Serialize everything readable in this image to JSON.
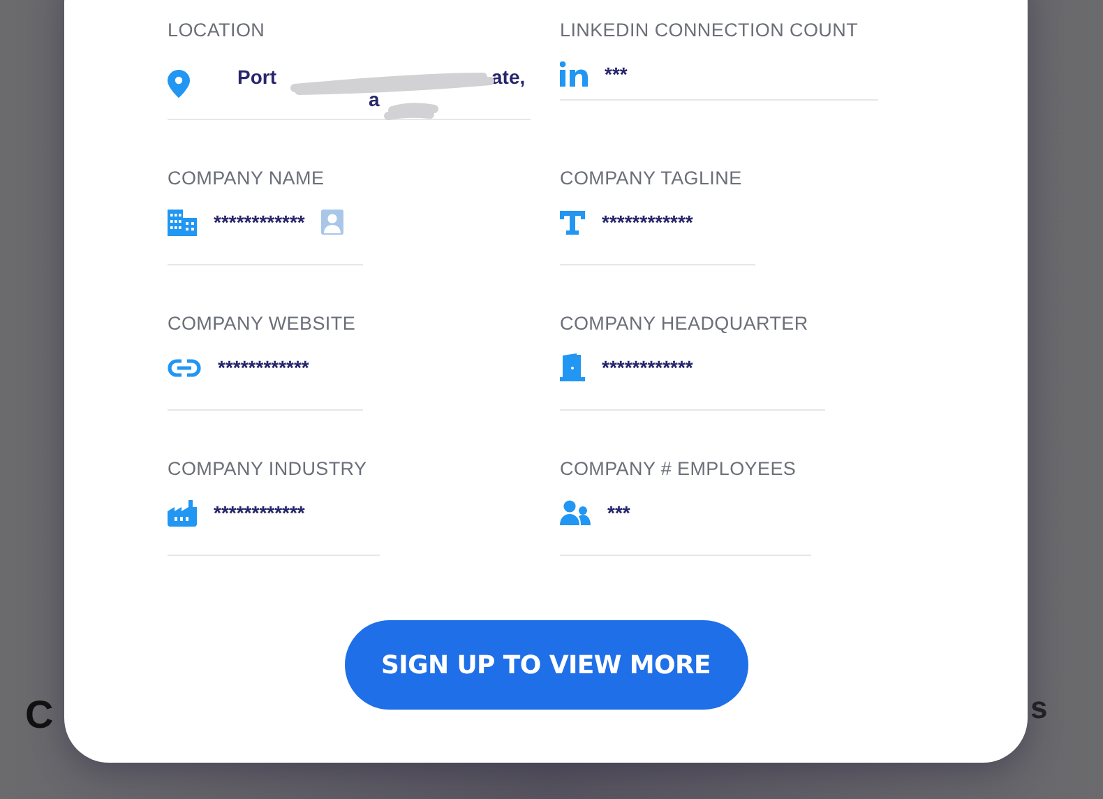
{
  "background_texts": [
    "C",
    "s"
  ],
  "fields": [
    {
      "label": "LOCATION",
      "value_parts": [
        "Port",
        "ate,",
        "a"
      ]
    },
    {
      "label": "LINKEDIN CONNECTION COUNT",
      "value": "***"
    },
    {
      "label": "COMPANY NAME",
      "value": "************",
      "badge": true
    },
    {
      "label": "COMPANY TAGLINE",
      "value": "************"
    },
    {
      "label": "COMPANY WEBSITE",
      "value": "************"
    },
    {
      "label": "COMPANY HEADQUARTER",
      "value": "************"
    },
    {
      "label": "COMPANY INDUSTRY",
      "value": "************"
    },
    {
      "label": "COMPANY # EMPLOYEES",
      "value": "***"
    }
  ],
  "button": "SIGN UP TO VIEW MORE"
}
